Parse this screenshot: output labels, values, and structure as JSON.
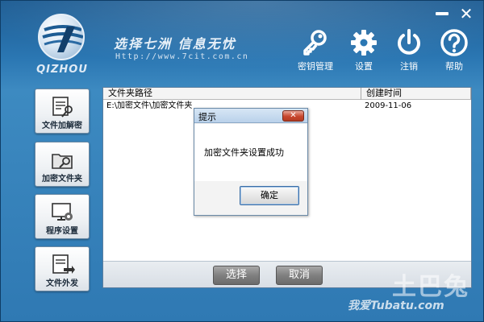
{
  "window": {
    "minimize_label": "",
    "close_label": "✕"
  },
  "brand": {
    "logo_text": "QIZHOU",
    "slogan": "选择七洲  信息无忧",
    "url": "Http://www.7cit.com.cn"
  },
  "toolbar": {
    "keys_label": "密钥管理",
    "settings_label": "设置",
    "logout_label": "注销",
    "help_label": "帮助"
  },
  "sidebar": {
    "items": [
      {
        "label": "文件加解密",
        "icon": "file-key-icon"
      },
      {
        "label": "加密文件夹",
        "icon": "folder-key-icon"
      },
      {
        "label": "程序设置",
        "icon": "monitor-gear-icon"
      },
      {
        "label": "文件外发",
        "icon": "file-send-icon"
      }
    ]
  },
  "table": {
    "columns": {
      "path": "文件夹路径",
      "time": "创建时间"
    },
    "rows": [
      {
        "path": "E:\\加密文件\\加密文件夹",
        "time": "2009-11-06"
      }
    ]
  },
  "actions": {
    "select_label": "选择",
    "cancel_label": "取消"
  },
  "dialog": {
    "title": "提示",
    "close_label": "✕",
    "message": "加密文件夹设置成功",
    "ok_label": "确定"
  },
  "watermark": {
    "big": "土巴兔",
    "small": "我爱Tubatu.com"
  },
  "colors": {
    "app_blue": "#2f79b3",
    "header_blue": "#1d5c93",
    "dialog_close_red": "#c8462d",
    "button_gray": "#808080"
  }
}
